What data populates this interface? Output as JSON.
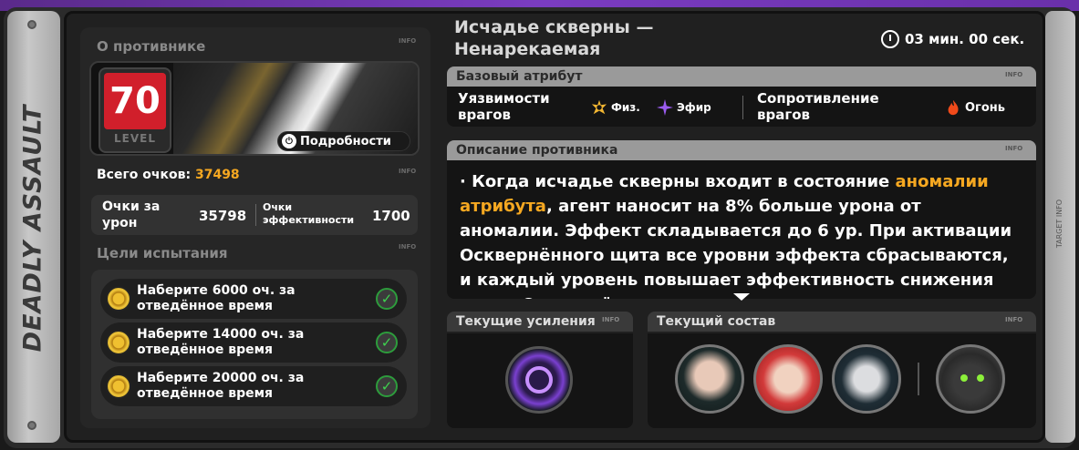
{
  "side_label": "DEADLY ASSAULT",
  "right_label": "TARGET INFO",
  "info_tag": "INFO",
  "enemy_section": {
    "title": "О противнике",
    "level": "70",
    "level_label": "LEVEL",
    "details_button": "Подробности"
  },
  "scores": {
    "total_label": "Всего очков:",
    "total_value": "37498",
    "damage_label": "Очки за урон",
    "damage_value": "35798",
    "efficiency_label": "Очки эффективности",
    "efficiency_value": "1700"
  },
  "goals": {
    "title": "Цели испытания",
    "items": [
      {
        "text": "Наберите 6000 оч. за отведённое время",
        "done": true
      },
      {
        "text": "Наберите 14000 оч. за отведённое время",
        "done": true
      },
      {
        "text": "Наберите 20000 оч. за отведённое время",
        "done": true
      }
    ]
  },
  "enemy_name": "Исчадье скверны — Ненарекаемая",
  "timer": "03 мин. 00 сек.",
  "base_attribute": {
    "title": "Базовый атрибут",
    "weakness_label": "Уязвимости врагов",
    "weaknesses": [
      "Физ.",
      "Эфир"
    ],
    "resistance_label": "Сопротивление врагов",
    "resistances": [
      "Огонь"
    ]
  },
  "description": {
    "title": "Описание противника",
    "prefix": "· Когда исчадье скверны входит в состояние ",
    "highlight": "аномалии атрибута",
    "text": ", агент наносит на 8% больше урона от аномалии. Эффект складывается до 6 ур. При активации Осквернённого щита все уровни эффекта сбрасываются, и каждый уровень повышает эффективность снижения урона Осквернённым щитом"
  },
  "buffs": {
    "title": "Текущие усиления"
  },
  "team": {
    "title": "Текущий состав"
  },
  "colors": {
    "accent": "#f6a821",
    "level_bg": "#d11f2b",
    "check": "#3fd24f",
    "frame_purple": "#7a3cc0"
  }
}
